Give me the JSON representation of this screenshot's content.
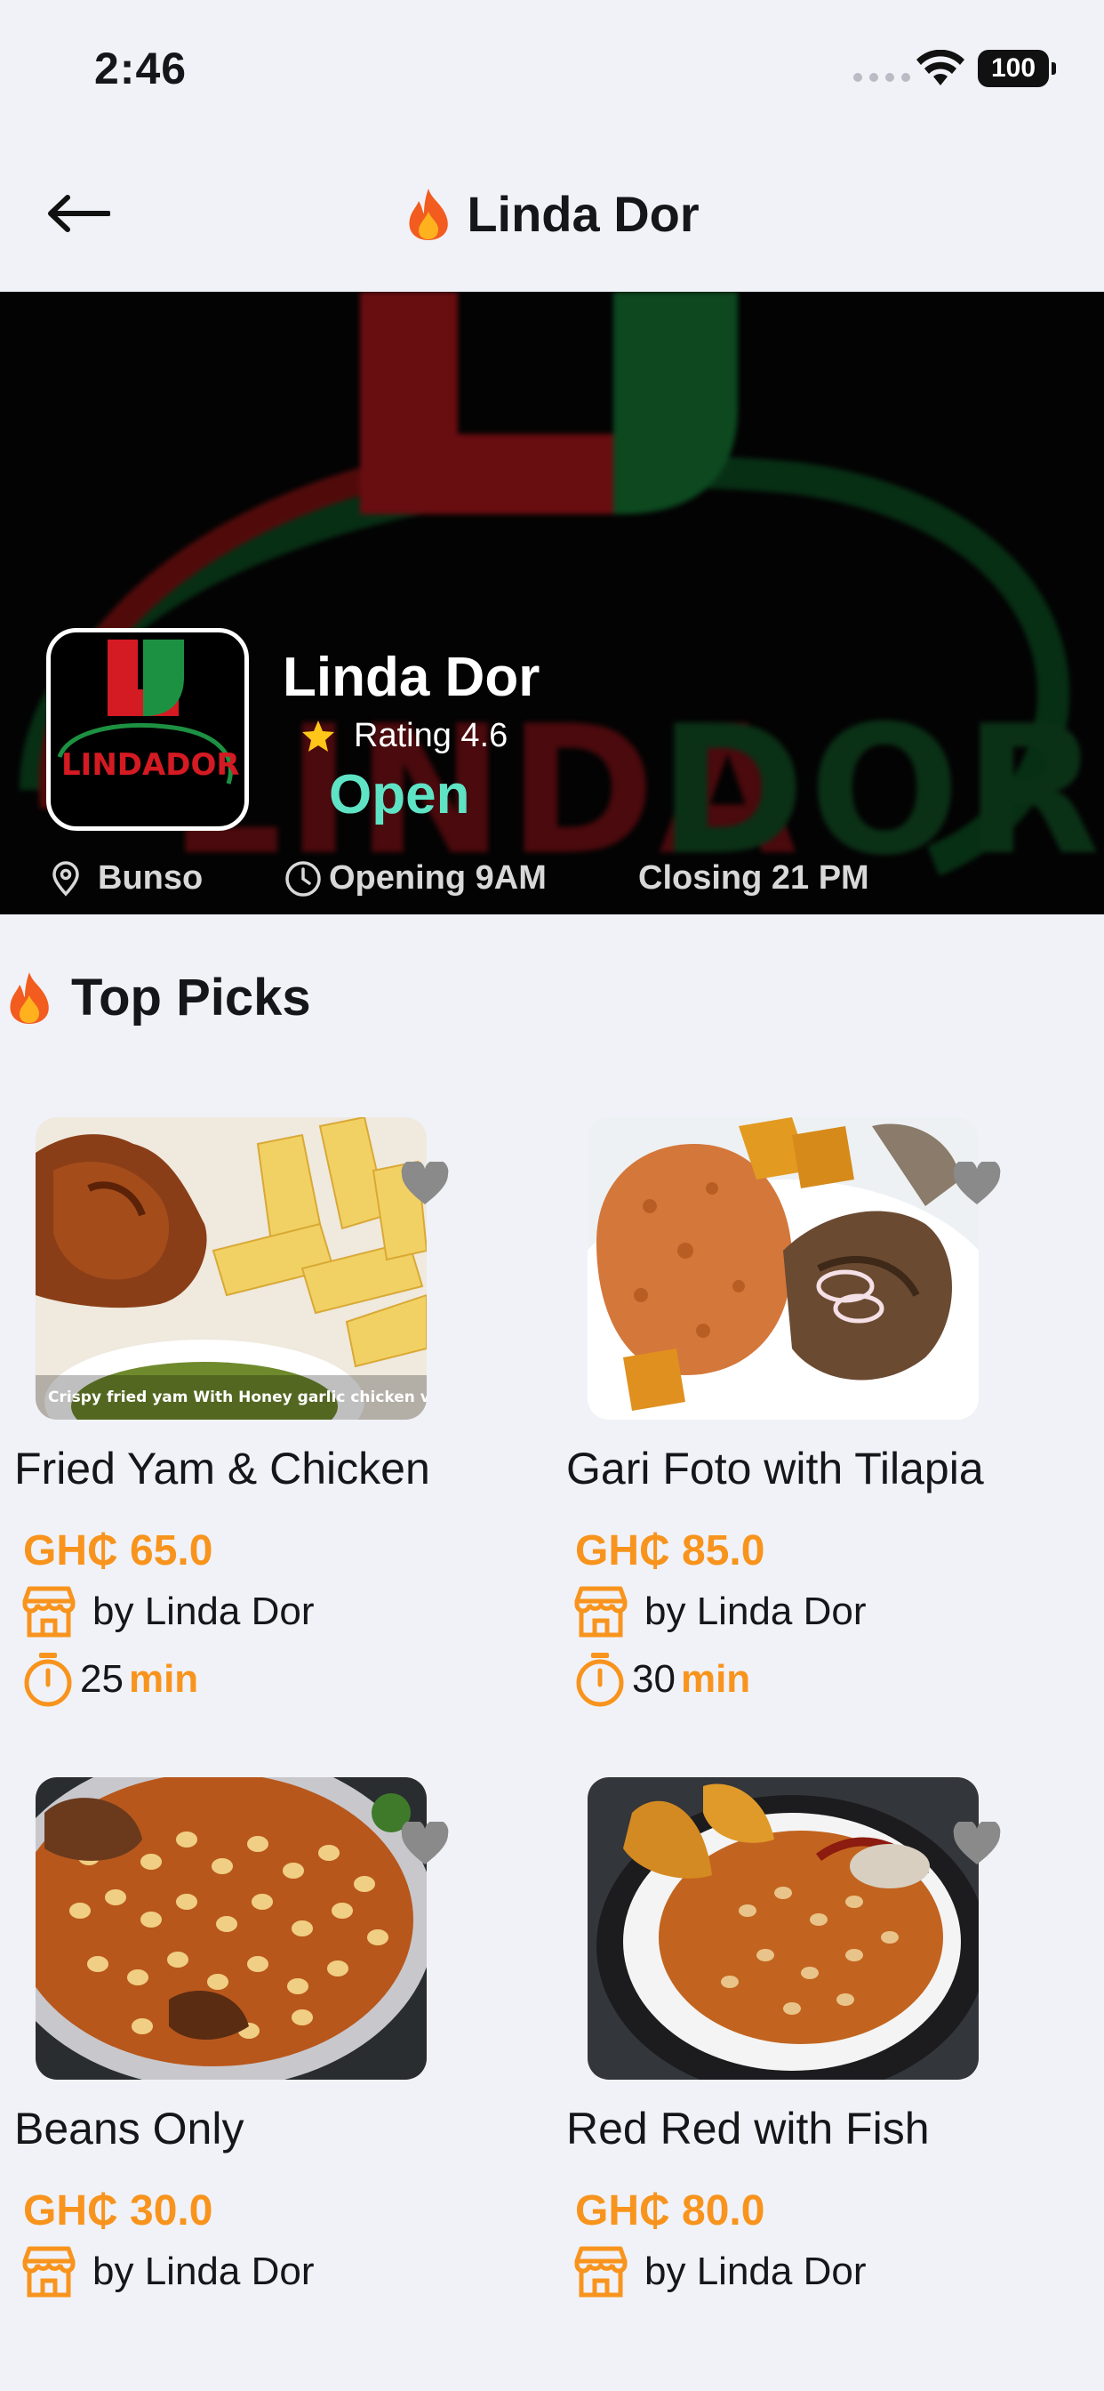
{
  "status_bar": {
    "time": "2:46",
    "battery": "100"
  },
  "header": {
    "title": "Linda Dor"
  },
  "restaurant": {
    "logo_text": "LINDADOR",
    "name": "Linda Dor",
    "rating": "Rating 4.6",
    "status": "Open",
    "location": "Bunso",
    "opening": "Opening 9AM",
    "closing": "Closing 21 PM"
  },
  "section": {
    "title": "Top Picks"
  },
  "products": [
    {
      "name": "Fried Yam & Chicken",
      "price": "GH₵ 65.0",
      "vendor": "by Linda Dor",
      "time": "25",
      "time_unit": "min",
      "image_caption": "Crispy fried yam With Honey garlic chicken v"
    },
    {
      "name": "Gari Foto with Tilapia",
      "price": "GH₵ 85.0",
      "vendor": "by Linda Dor",
      "time": "30",
      "time_unit": "min"
    },
    {
      "name": "Beans Only",
      "price": "GH₵ 30.0",
      "vendor": "by Linda Dor"
    },
    {
      "name": "Red Red with Fish",
      "price": "GH₵ 80.0",
      "vendor": "by Linda Dor"
    }
  ],
  "colors": {
    "accent": "#f8941d",
    "open": "#5fe3c5",
    "background": "#f0f2f8",
    "heart": "#8a8a8a"
  }
}
